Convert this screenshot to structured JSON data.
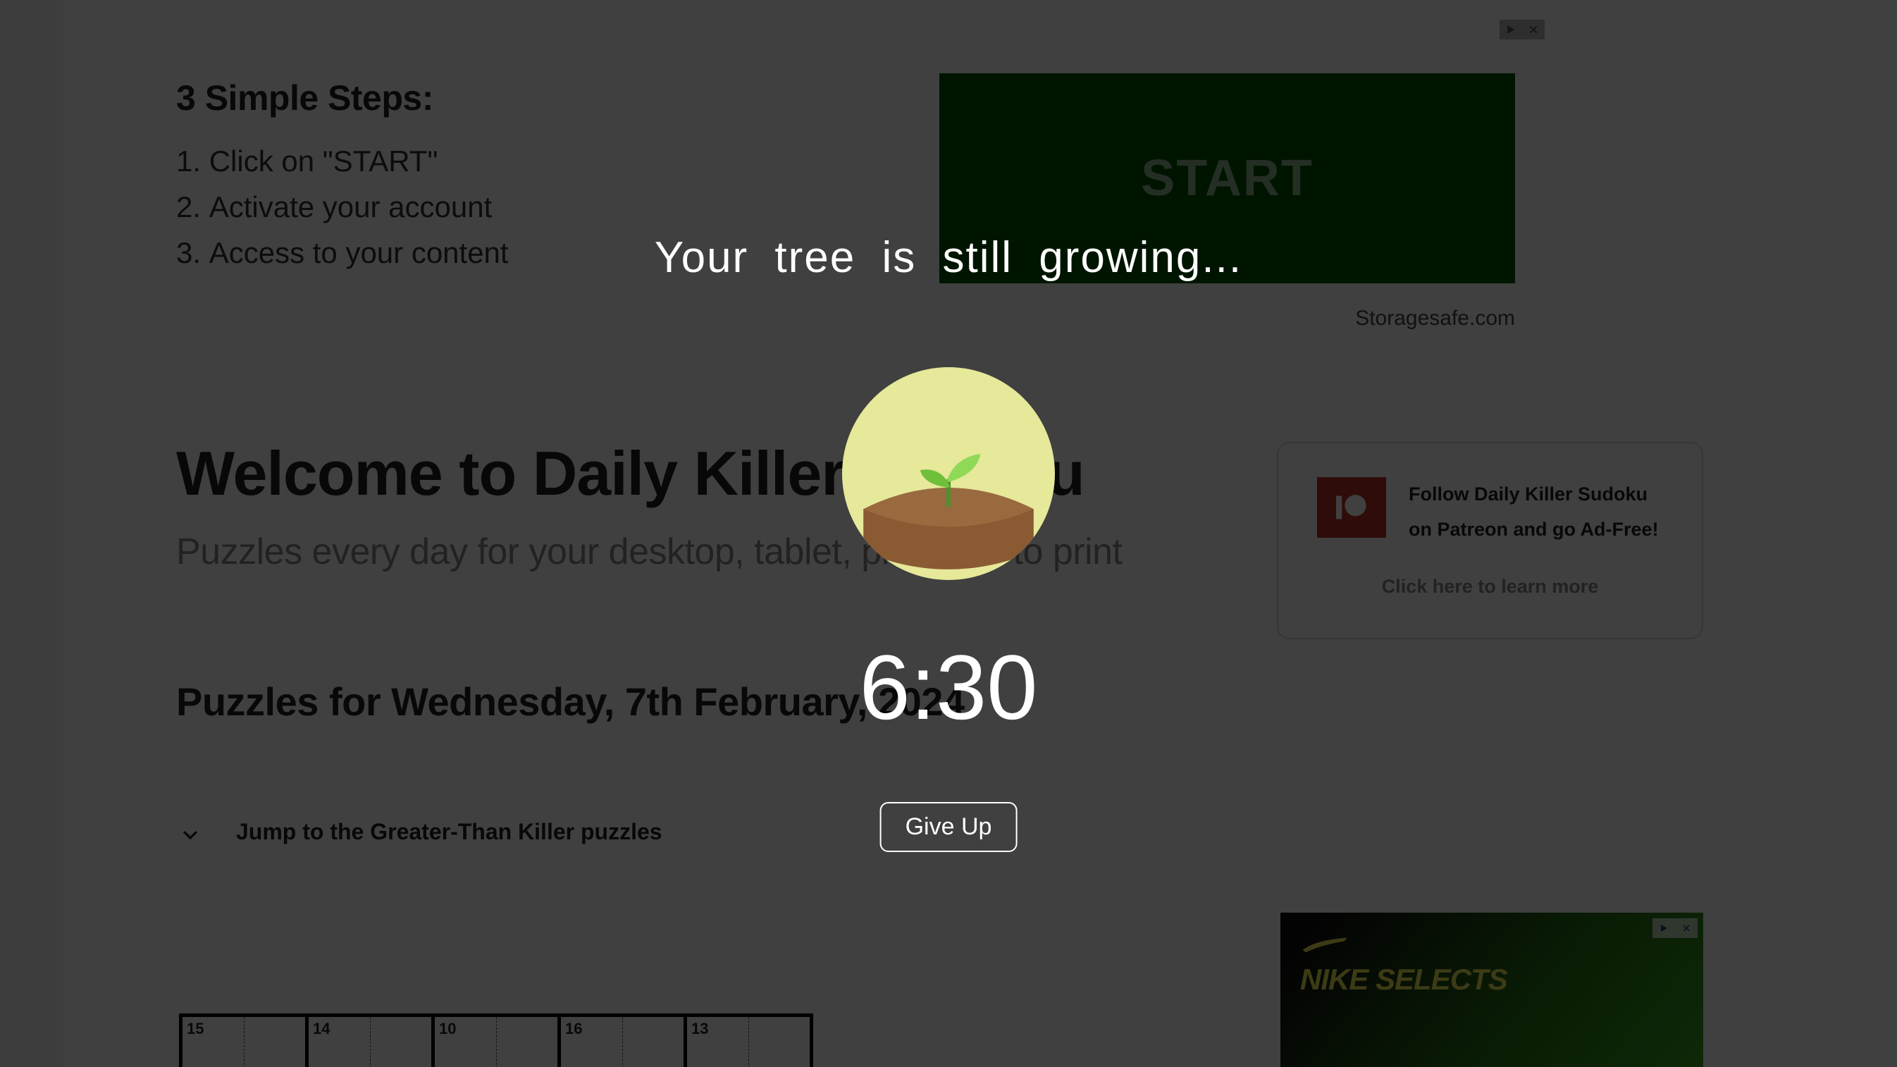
{
  "background": {
    "steps_heading": "3 Simple Steps:",
    "steps": [
      "Click on \"START\"",
      "Activate your account",
      "Access to your content"
    ],
    "start_button": "START",
    "ad_caption": "Storagesafe.com",
    "welcome_title": "Welcome to Daily Killer Sudoku",
    "welcome_sub": "Puzzles every day for your desktop, tablet, phone or to print",
    "puzzles_date": "Puzzles for Wednesday, 7th February, 2024",
    "jump_text": "Jump to the Greater-Than Killer puzzles",
    "patreon": {
      "line1": "Follow Daily Killer Sudoku",
      "line2": "on Patreon and go Ad-Free!",
      "learn": "Click here to learn more"
    },
    "nike_ad_title": "NIKE SELECTS",
    "sudoku_cells": [
      "15",
      "",
      "14",
      "",
      "10",
      "",
      "16",
      "",
      "13",
      ""
    ]
  },
  "overlay": {
    "caption": "Your tree is still growing...",
    "timer": "6:30",
    "give_up": "Give Up"
  }
}
